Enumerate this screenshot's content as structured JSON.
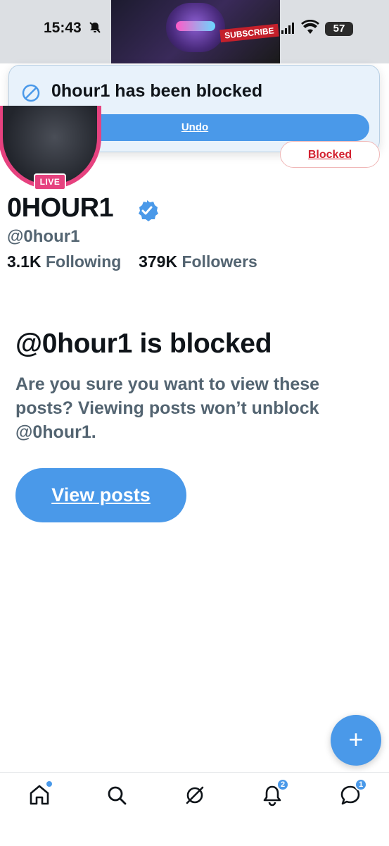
{
  "status_bar": {
    "time": "15:43",
    "battery": "57",
    "icons": [
      "silent-icon",
      "signal-icon",
      "wifi-icon",
      "battery-icon"
    ]
  },
  "banner": {
    "subscribe_text": "SUBSCRIBE"
  },
  "toast": {
    "message": "0hour1 has been blocked",
    "undo_label": "Undo",
    "icon": "blocked-icon"
  },
  "profile": {
    "live_label": "LIVE",
    "blocked_button_label": "Blocked",
    "display_name": "0HOUR1",
    "handle": "@0hour1",
    "following_count": "3.1K",
    "following_label": "Following",
    "followers_count": "379K",
    "followers_label": "Followers"
  },
  "blocked_notice": {
    "title": "@0hour1 is blocked",
    "description": "Are you sure you want to view these posts? Viewing posts won’t unblock @0hour1.",
    "view_posts_label": "View posts"
  },
  "fab": {
    "label": "+"
  },
  "bottom_nav": {
    "notifications_badge": "2",
    "messages_badge": "1"
  },
  "colors": {
    "accent": "#4a99e9",
    "live": "#e6427f",
    "blocked": "#d3202f",
    "secondary_text": "#536471"
  }
}
